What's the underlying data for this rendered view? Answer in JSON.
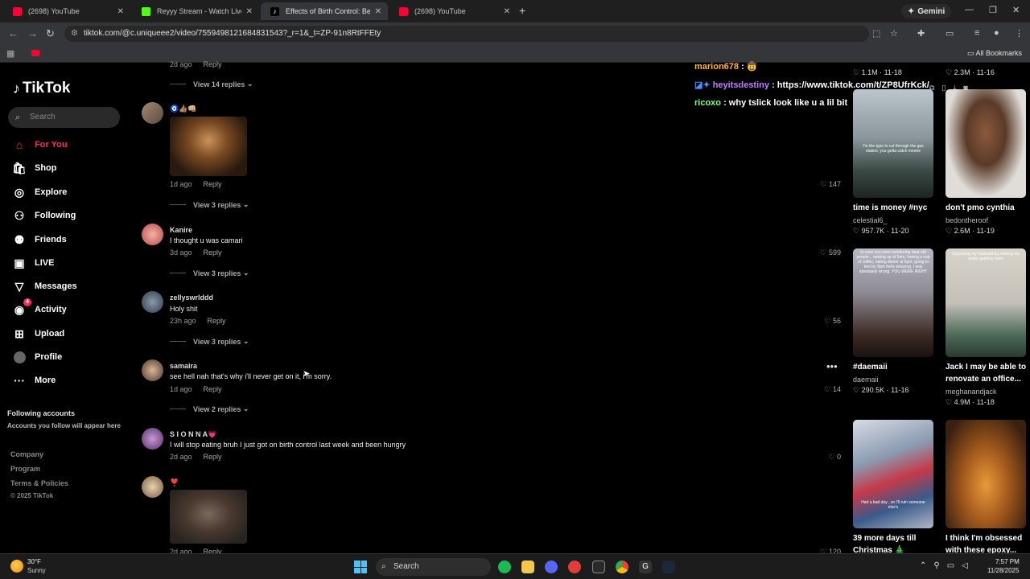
{
  "browser": {
    "tabs": [
      {
        "title": "(2698) YouTube",
        "favicon": "youtube",
        "color": "#ff0033"
      },
      {
        "title": "Reyyy Stream - Watch Live on K",
        "favicon": "kick",
        "color": "#53fc18"
      },
      {
        "title": "Effects of Birth Control: Before",
        "favicon": "tiktok",
        "color": "#ffffff",
        "active": true
      },
      {
        "title": "(2698) YouTube",
        "favicon": "youtube",
        "color": "#ff0033"
      }
    ],
    "gemini_label": "Gemini",
    "url": "tiktok.com/@c.uniqueee2/video/7559498121684831543?_r=1&_t=ZP-91n8RtFFEty",
    "all_bookmarks": "All Bookmarks"
  },
  "sidebar": {
    "logo": "TikTok",
    "search_placeholder": "Search",
    "nav": [
      {
        "label": "For You",
        "icon": "home-icon",
        "active": true
      },
      {
        "label": "Shop",
        "icon": "shop-bag-icon"
      },
      {
        "label": "Explore",
        "icon": "compass-icon"
      },
      {
        "label": "Following",
        "icon": "following-user-icon"
      },
      {
        "label": "Friends",
        "icon": "friends-icon"
      },
      {
        "label": "LIVE",
        "icon": "live-icon"
      },
      {
        "label": "Messages",
        "icon": "messages-icon"
      },
      {
        "label": "Activity",
        "icon": "activity-icon",
        "badge": "4"
      },
      {
        "label": "Upload",
        "icon": "upload-icon"
      },
      {
        "label": "Profile",
        "icon": "profile-avatar"
      },
      {
        "label": "More",
        "icon": "more-icon"
      }
    ],
    "following_accounts_title": "Following accounts",
    "following_accounts_sub": "Accounts you follow will appear here",
    "footer": [
      "Company",
      "Program",
      "Terms & Policies",
      "© 2025 TikTok"
    ]
  },
  "comments": {
    "top_partial": {
      "meta": "2d ago",
      "reply": "Reply",
      "view_replies": "View 14 replies"
    },
    "items": [
      {
        "name": "",
        "emoji": "🧿👍🏽👊🏼",
        "text": "",
        "image": true,
        "time": "1d ago",
        "reply": "Reply",
        "likes": "147",
        "view_replies": "View 3 replies"
      },
      {
        "name": "Kanire",
        "text": "I thought u was camari",
        "time": "3d ago",
        "reply": "Reply",
        "likes": "599",
        "view_replies": "View 3 replies"
      },
      {
        "name": "zellyswrlddd",
        "text": "Holy shit",
        "time": "23h ago",
        "reply": "Reply",
        "likes": "56",
        "view_replies": "View 3 replies"
      },
      {
        "name": "samaira",
        "text": "see hell nah that's why i'll never get on it, i'm sorry.",
        "time": "1d ago",
        "reply": "Reply",
        "likes": "14",
        "view_replies": "View 2 replies"
      },
      {
        "name": "S I O N N A💗",
        "text": "I will stop eating bruh I just got on birth control last week and been hungry",
        "time": "2d ago",
        "reply": "Reply",
        "likes": "0",
        "view_replies": ""
      },
      {
        "name": "❣️",
        "text": "",
        "image": true,
        "time": "2d ago",
        "reply": "Reply",
        "likes": "120",
        "view_replies": ""
      }
    ]
  },
  "chat_overlay": [
    {
      "user": "marion678",
      "msg": ": 🤠",
      "color": "#ffb43c"
    },
    {
      "user": "heyitsdestiny",
      "msg": ": https://www.tiktok.com/t/ZP8UfrKck/",
      "color": "#c07bff"
    },
    {
      "user": "ricoxo",
      "msg": ": why tslick look like u a lil bit",
      "color": "#7dff7d"
    }
  ],
  "top_stats": [
    {
      "stat": "1.1M · 11-18"
    },
    {
      "stat": "2.3M · 11-16"
    }
  ],
  "videos": [
    {
      "title": "time is money #nyc",
      "user": "celestial6_",
      "stat": "957.7K · 11-20",
      "caption": "I'm the type to cut through the gas station, you gotta catch meeee"
    },
    {
      "title": "don't pmo cynthia",
      "user": "bedontheroof",
      "stat": "2.6M · 11-19",
      "caption": ""
    },
    {
      "title": "#daemaii",
      "user": "daemaii",
      "stat": "290.5K · 11-16",
      "caption": "In case you were wondering dear old people... waking up at 5am, having a cup of coffee, eating dinner at 6pm, going to bed by 9pm feels amazing. I was absolutely wrong. YOU WERE RIGHT"
    },
    {
      "title": "Jack I may be able to",
      "title2": "renovate an office...",
      "user": "meghanandjack",
      "stat": "4.9M · 11-18",
      "caption": "Surprising my husband by redoing his entire gaming room"
    },
    {
      "title": "39 more days till",
      "title2": "Christmas 🎄",
      "user": "",
      "stat": "",
      "caption": "Had a bad day , so I'll ruin someone else's"
    },
    {
      "title": "I think I'm obsessed",
      "title2": "with these epoxy...",
      "user": "",
      "stat": "",
      "caption": ""
    }
  ],
  "taskbar": {
    "temp": "30°F",
    "weather": "Sunny",
    "search": "Search",
    "time": "7:57 PM",
    "date": "11/28/2025"
  }
}
